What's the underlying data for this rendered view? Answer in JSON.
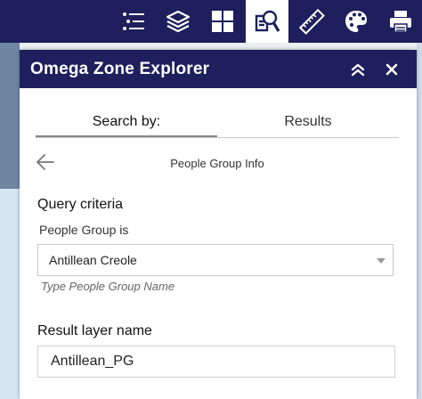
{
  "toolbar": {
    "tools": [
      {
        "icon": "layer-list-icon"
      },
      {
        "icon": "layers-stack-icon"
      },
      {
        "icon": "grid-apps-icon"
      },
      {
        "icon": "search-document-icon",
        "active": true
      },
      {
        "icon": "ruler-measure-icon"
      },
      {
        "icon": "palette-icon"
      },
      {
        "icon": "printer-icon"
      }
    ],
    "background_color": "#1e1f5c"
  },
  "panel": {
    "title": "Omega Zone Explorer",
    "collapse_icon": "double-chevron-up-icon",
    "close_icon": "close-icon"
  },
  "tabs": [
    {
      "label": "Search by:",
      "active": true
    },
    {
      "label": "Results",
      "active": false
    }
  ],
  "back": {
    "icon": "back-arrow-icon",
    "title": "People Group Info"
  },
  "query": {
    "section_label": "Query criteria",
    "field_label": "People Group is",
    "selected_value": "Antillean Creole",
    "hint": "Type People Group Name"
  },
  "result": {
    "label": "Result layer name",
    "value": "Antillean_PG"
  }
}
